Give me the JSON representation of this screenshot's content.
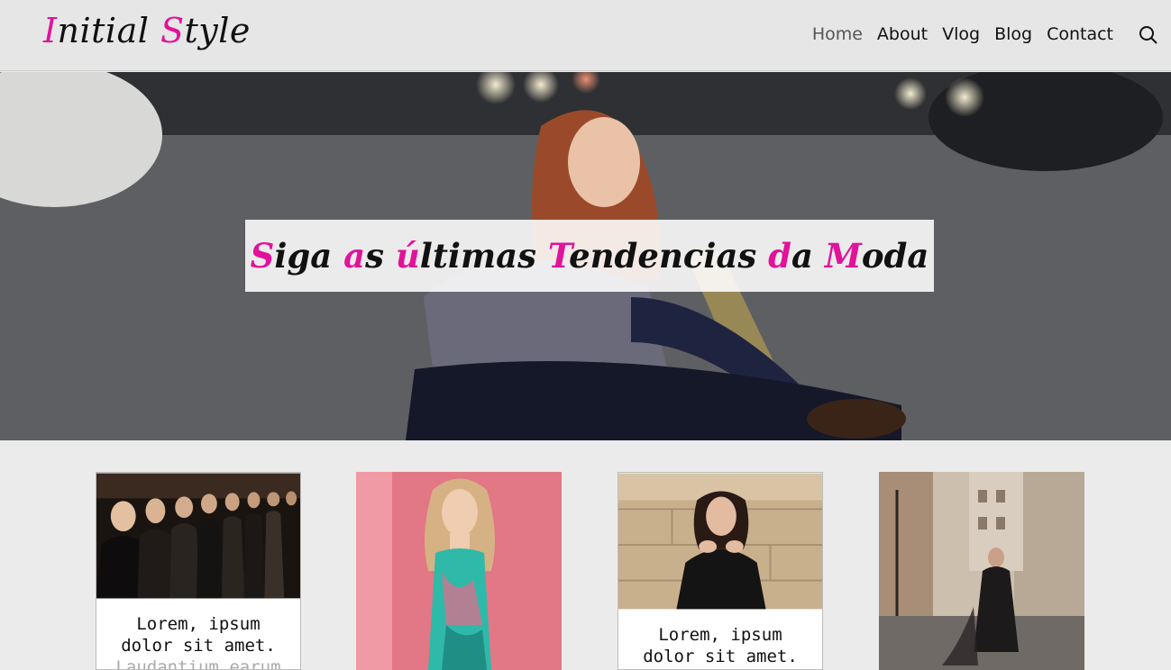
{
  "header": {
    "logo_first_initial": "I",
    "logo_first_rest": "nitial ",
    "logo_second_initial": "S",
    "logo_second_rest": "tyle",
    "nav": [
      {
        "label": "Home",
        "active": true
      },
      {
        "label": "About",
        "active": false
      },
      {
        "label": "Vlog",
        "active": false
      },
      {
        "label": "Blog",
        "active": false
      },
      {
        "label": "Contact",
        "active": false
      }
    ],
    "search_icon": "search-icon"
  },
  "hero": {
    "title_parts": [
      {
        "accent": "S",
        "rest": "iga "
      },
      {
        "accent": "a",
        "rest": "s "
      },
      {
        "accent": "ú",
        "rest": "ltimas "
      },
      {
        "accent": "T",
        "rest": "endencias "
      },
      {
        "accent": "d",
        "rest": "a "
      },
      {
        "accent": "M",
        "rest": "oda"
      }
    ]
  },
  "cards": [
    {
      "text_line1": "Lorem, ipsum",
      "text_line2": "dolor sit amet.",
      "text_line3": "Laudantium earum"
    },
    {
      "text_line1": "",
      "text_line2": "",
      "text_line3": ""
    },
    {
      "text_line1": "Lorem, ipsum",
      "text_line2": "dolor sit amet.",
      "text_line3": ""
    },
    {
      "text_line1": "",
      "text_line2": "",
      "text_line3": ""
    }
  ],
  "colors": {
    "accent": "#e0139a",
    "header_bg": "#e6e6e6",
    "page_bg": "#ebebeb"
  }
}
